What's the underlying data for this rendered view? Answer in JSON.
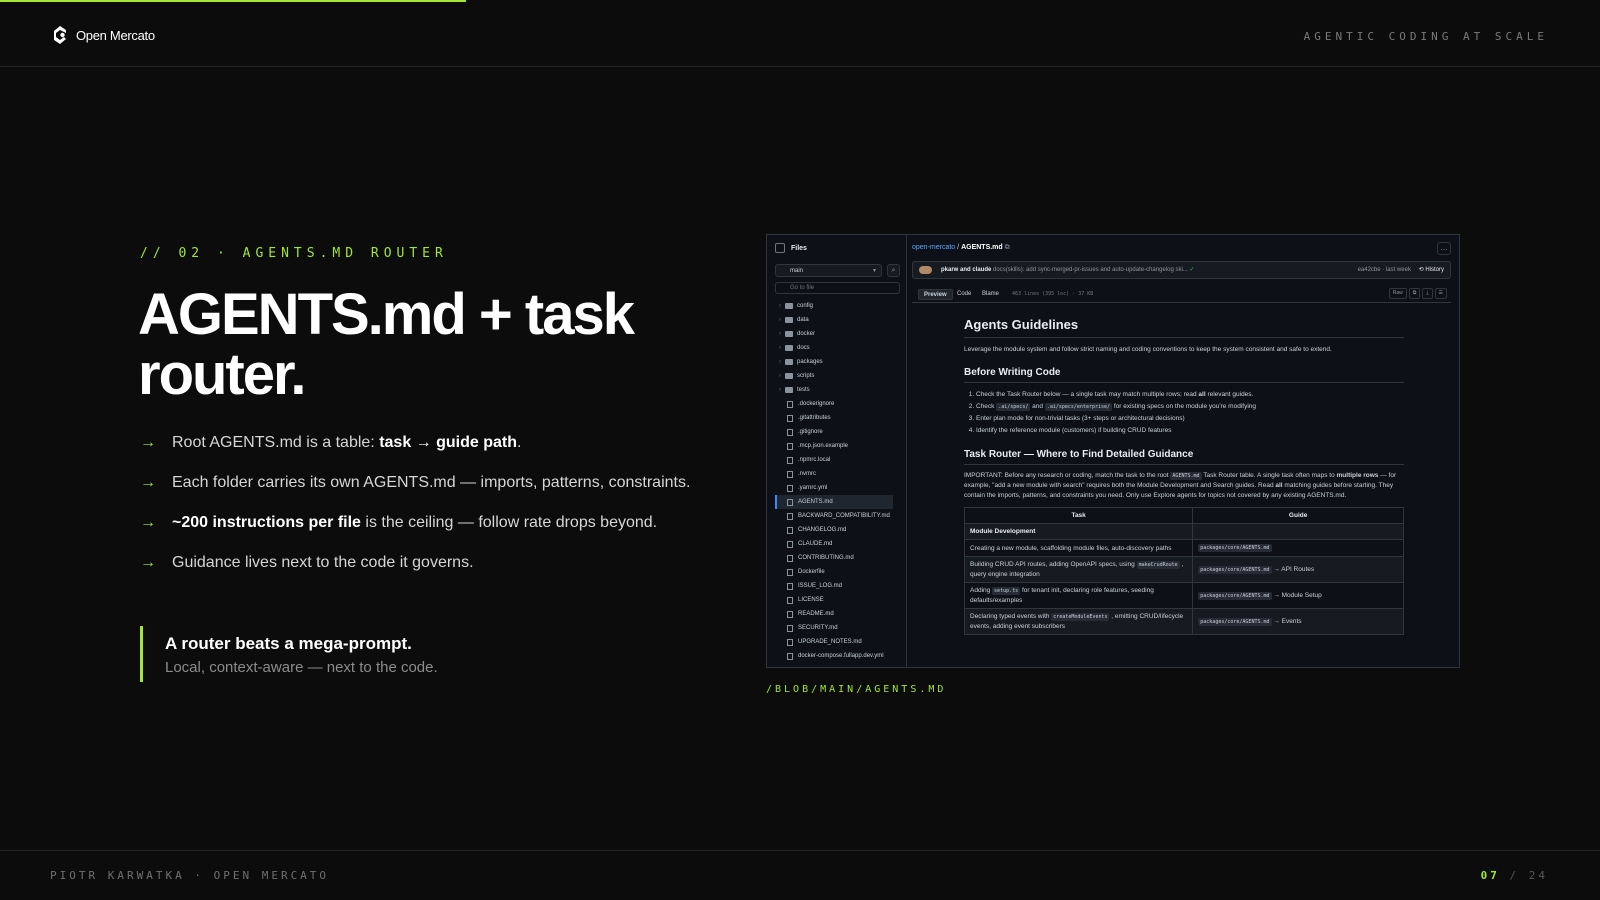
{
  "header": {
    "logo_text": "Open Mercato",
    "tagline": "AGENTIC CODING AT SCALE"
  },
  "slide": {
    "kicker": "// 02 · AGENTS.MD ROUTER",
    "title": "AGENTS.md + task router.",
    "bullets": [
      {
        "pre": "Root AGENTS.md is a table: ",
        "bold": "task → guide path",
        "post": "."
      },
      {
        "pre": "Each folder carries its own AGENTS.md — imports, patterns, constraints.",
        "bold": "",
        "post": ""
      },
      {
        "pre": "",
        "bold": "~200 instructions per file",
        "post": " is the ceiling — follow rate drops beyond."
      },
      {
        "pre": "Guidance lives next to the code it governs.",
        "bold": "",
        "post": ""
      }
    ],
    "bullet_arrow": "→",
    "quote_title": "A router beats a mega-prompt.",
    "quote_sub": "Local, context-aware — next to the code.",
    "caption": "/BLOB/MAIN/AGENTS.MD"
  },
  "footer": {
    "left": "PIOTR KARWATKA · OPEN MERCATO",
    "page_current": "07",
    "page_sep": "/",
    "page_total": "24"
  },
  "screenshot": {
    "sidebar_title": "Files",
    "branch": "main",
    "go_to_file_placeholder": "Go to file",
    "folders": [
      "config",
      "data",
      "docker",
      "docs",
      "packages",
      "scripts",
      "tests"
    ],
    "files": [
      ".dockerignore",
      ".gitattributes",
      ".gitignore",
      ".mcp.json.example",
      ".npmrc.local",
      ".nvmrc",
      ".yarnrc.yml",
      "AGENTS.md",
      "BACKWARD_COMPATIBILITY.md",
      "CHANGELOG.md",
      "CLAUDE.md",
      "CONTRIBUTING.md",
      "Dockerfile",
      "ISSUE_LOG.md",
      "LICENSE",
      "README.md",
      "SECURITY.md",
      "UPGRADE_NOTES.md",
      "docker-compose.fullapp.dev.yml"
    ],
    "selected_file": "AGENTS.md",
    "breadcrumb_repo": "open-mercato",
    "breadcrumb_sep": "/",
    "breadcrumb_file": "AGENTS.md",
    "commit_authors": "pkarw and claude",
    "commit_message": "docs(skills): add sync-merged-pr-issues and auto-update-changelog ski...",
    "commit_meta": "ea42cbe · last week",
    "history_label": "History",
    "tabs": [
      "Preview",
      "Code",
      "Blame"
    ],
    "lines_info": "463 lines (395 loc) · 37 KB",
    "raw_label": "Raw",
    "doc_title": "Agents Guidelines",
    "doc_intro": "Leverage the module system and follow strict naming and coding conventions to keep the system consistent and safe to extend.",
    "h_before": "Before Writing Code",
    "steps": [
      {
        "pre": "Check the Task Router below — a single task may match multiple rows; read ",
        "b": "all",
        "post": " relevant guides."
      },
      {
        "pre": "Check ",
        "c1": ".ai/specs/",
        "mid": " and ",
        "c2": ".ai/specs/enterprise/",
        "post": " for existing specs on the module you're modifying"
      },
      {
        "pre": "Enter plan mode for non-trivial tasks (3+ steps or architectural decisions)"
      },
      {
        "pre": "Identify the reference module (customers) if building CRUD features"
      }
    ],
    "h_router": "Task Router — Where to Find Detailed Guidance",
    "router_p1": "IMPORTANT: Before any research or coding, match the task to the root ",
    "router_code": "AGENTS.md",
    "router_p2": " Task Router table. A single task often maps to ",
    "router_b1": "multiple rows",
    "router_p3": " — for example, \"add a new module with search\" requires both the Module Development and Search guides. Read ",
    "router_b2": "all",
    "router_p4": " matching guides before starting. They contain the imports, patterns, and constraints you need. Only use Explore agents for topics not covered by any existing AGENTS.md.",
    "table_headers": [
      "Task",
      "Guide"
    ],
    "table_group": "Module Development",
    "rows": [
      {
        "task": "Creating a new module, scaffolding module files, auto-discovery paths",
        "guide_code": "packages/core/AGENTS.md",
        "guide_post": ""
      },
      {
        "task_pre": "Building CRUD API routes, adding OpenAPI specs, using ",
        "task_code": "makeCrudRoute",
        "task_post": " , query engine integration",
        "guide_code": "packages/core/AGENTS.md",
        "guide_post": " → API Routes"
      },
      {
        "task_pre": "Adding ",
        "task_code": "setup.ts",
        "task_post": " for tenant init, declaring role features, seeding defaults/examples",
        "guide_code": "packages/core/AGENTS.md",
        "guide_post": " → Module Setup"
      },
      {
        "task_pre": "Declaring typed events with ",
        "task_code": "createModuleEvents",
        "task_post": " , emitting CRUD/lifecycle events, adding event subscribers",
        "guide_code": "packages/core/AGENTS.md",
        "guide_post": " → Events"
      }
    ]
  },
  "colors": {
    "accent": "#a3e635",
    "background": "#0c0c0c",
    "github_bg": "#0d1117",
    "link": "#58a6ff"
  }
}
